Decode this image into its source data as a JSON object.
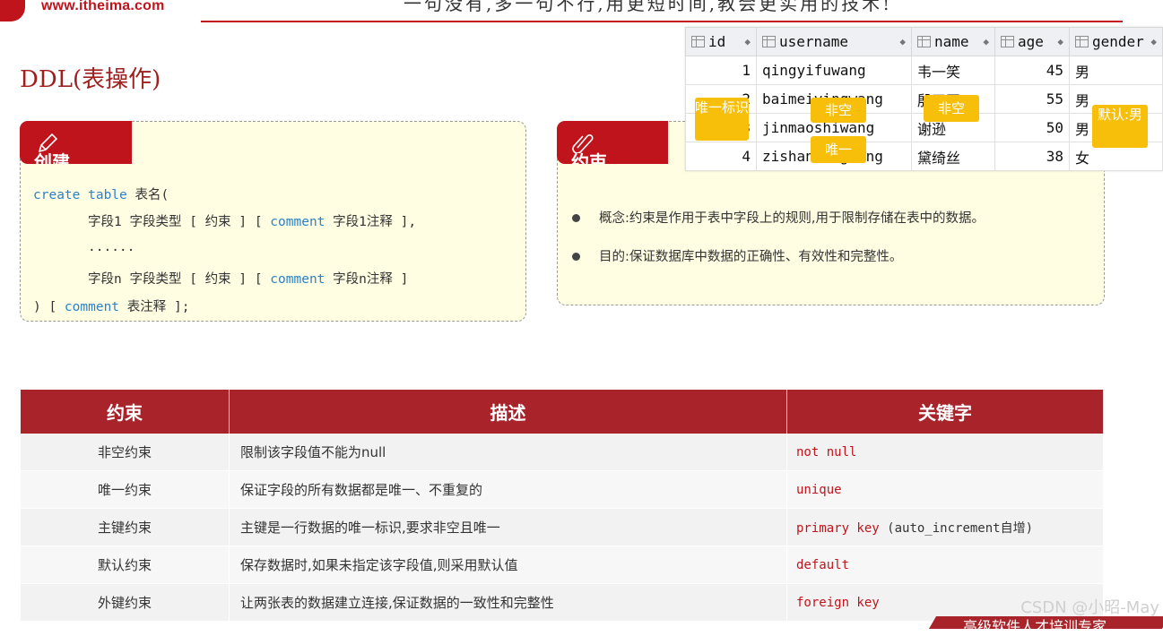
{
  "header": {
    "logo_text": "www.itheima.com",
    "slogan": "一句没有,多一句不行,用更短时间,教会更实用的技术!"
  },
  "page_title": "DDL(表操作)",
  "create_card": {
    "tab_label": "创建",
    "code": {
      "l1_kw": "create table",
      "l1_rest": "表名(",
      "l2_a": "字段1 字段类型 [ 约束 ] [ ",
      "l2_kw": "comment",
      "l2_b": " 字段1注释 ],",
      "l3": "......",
      "l4_a": "字段n 字段类型 [ 约束 ] [ ",
      "l4_kw": "comment",
      "l4_b": " 字段n注释 ]",
      "l5_a": ") [ ",
      "l5_kw": "comment",
      "l5_b": " 表注释 ];"
    }
  },
  "constraint_card": {
    "tab_label": "约束",
    "bullets": [
      "概念:约束是作用于表中字段上的规则,用于限制存储在表中的数据。",
      "目的:保证数据库中数据的正确性、有效性和完整性。"
    ]
  },
  "db_grid": {
    "columns": [
      "id",
      "username",
      "name",
      "age",
      "gender"
    ],
    "rows": [
      [
        "1",
        "qingyifuwang",
        "韦一笑",
        "45",
        "男"
      ],
      [
        "2",
        "baimeiyingwang",
        "殷天正",
        "55",
        "男"
      ],
      [
        "3",
        "jinmaoshiwang",
        "谢逊",
        "50",
        "男"
      ],
      [
        "4",
        "zishanlongwang",
        "黛绮丝",
        "38",
        "女"
      ]
    ]
  },
  "tags": {
    "unique_id": "唯一标识",
    "notnull_username": "非空",
    "unique_username": "唯一",
    "notnull_name": "非空",
    "default_gender": "默认:男"
  },
  "constraints_table": {
    "headers": [
      "约束",
      "描述",
      "关键字"
    ],
    "rows": [
      {
        "name": "非空约束",
        "desc": "限制该字段值不能为null",
        "kw": "not null",
        "extra": ""
      },
      {
        "name": "唯一约束",
        "desc": "保证字段的所有数据都是唯一、不重复的",
        "kw": "unique",
        "extra": ""
      },
      {
        "name": "主键约束",
        "desc": "主键是一行数据的唯一标识,要求非空且唯一",
        "kw": "primary key",
        "extra": "(auto_increment自增)"
      },
      {
        "name": "默认约束",
        "desc": "保存数据时,如果未指定该字段值,则采用默认值",
        "kw": "default",
        "extra": ""
      },
      {
        "name": "外键约束",
        "desc": "让两张表的数据建立连接,保证数据的一致性和完整性",
        "kw": "foreign key",
        "extra": ""
      }
    ]
  },
  "watermark": "CSDN @小昭-May",
  "footer_text": "高级软件人才培训专家",
  "colors": {
    "brand_red": "#c0141c",
    "table_header": "#a8232a",
    "tag_yellow": "#f7bf0a",
    "card_bg": "#fffde2",
    "keyword_blue": "#2b82c8"
  }
}
